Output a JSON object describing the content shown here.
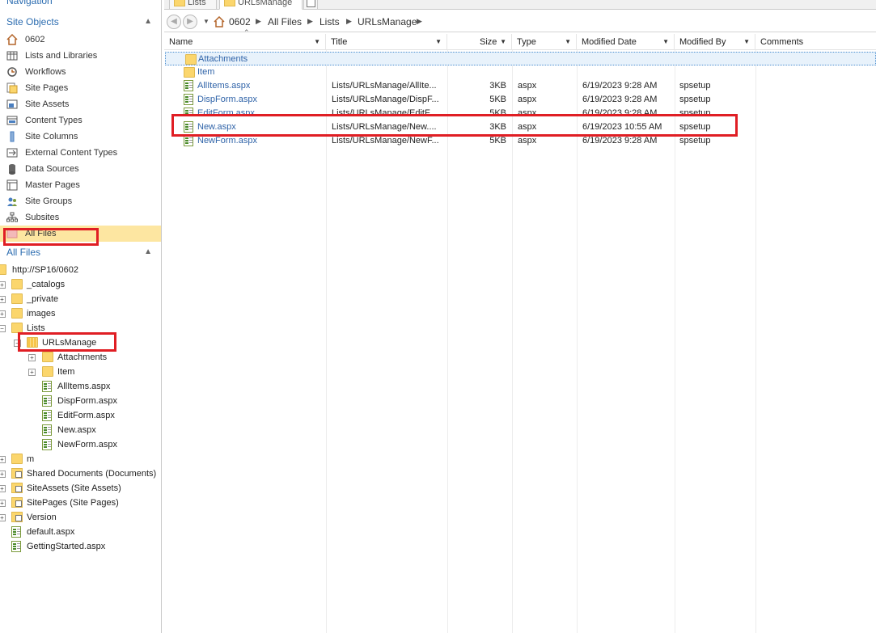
{
  "nav": {
    "title": "Navigation",
    "site_objects_header": "Site Objects",
    "site_objects": [
      {
        "label": "0602",
        "icon": "home-icon"
      },
      {
        "label": "Lists and Libraries",
        "icon": "list-icon"
      },
      {
        "label": "Workflows",
        "icon": "workflow-icon"
      },
      {
        "label": "Site Pages",
        "icon": "site-pages-icon"
      },
      {
        "label": "Site Assets",
        "icon": "site-assets-icon"
      },
      {
        "label": "Content Types",
        "icon": "content-types-icon"
      },
      {
        "label": "Site Columns",
        "icon": "site-columns-icon"
      },
      {
        "label": "External Content Types",
        "icon": "external-content-icon"
      },
      {
        "label": "Data Sources",
        "icon": "database-icon"
      },
      {
        "label": "Master Pages",
        "icon": "master-pages-icon"
      },
      {
        "label": "Site Groups",
        "icon": "groups-icon"
      },
      {
        "label": "Subsites",
        "icon": "subsites-icon"
      },
      {
        "label": "All Files",
        "icon": "all-files-icon"
      }
    ],
    "all_files_header": "All Files",
    "tree": {
      "root": "http://SP16/0602",
      "items": [
        {
          "label": "_catalogs"
        },
        {
          "label": "_private"
        },
        {
          "label": "images"
        },
        {
          "label": "Lists"
        },
        {
          "label": "URLsManage"
        },
        {
          "label": "Attachments"
        },
        {
          "label": "Item"
        },
        {
          "label": "AllItems.aspx"
        },
        {
          "label": "DispForm.aspx"
        },
        {
          "label": "EditForm.aspx"
        },
        {
          "label": "New.aspx"
        },
        {
          "label": "NewForm.aspx"
        },
        {
          "label": "m"
        },
        {
          "label": "Shared Documents (Documents)"
        },
        {
          "label": "SiteAssets (Site Assets)"
        },
        {
          "label": "SitePages (Site Pages)"
        },
        {
          "label": "Version"
        },
        {
          "label": "default.aspx"
        },
        {
          "label": "GettingStarted.aspx"
        }
      ]
    }
  },
  "tabs": [
    {
      "label": "Lists"
    },
    {
      "label": "URLsManage"
    }
  ],
  "breadcrumb": [
    "0602",
    "All Files",
    "Lists",
    "URLsManage"
  ],
  "columns": [
    "Name",
    "Title",
    "Size",
    "Type",
    "Modified Date",
    "Modified By",
    "Comments"
  ],
  "rows": [
    {
      "name": "Attachments",
      "title": "",
      "size": "",
      "type": "",
      "modified": "",
      "by": "",
      "kind": "folder"
    },
    {
      "name": "Item",
      "title": "",
      "size": "",
      "type": "",
      "modified": "",
      "by": "",
      "kind": "folder"
    },
    {
      "name": "AllItems.aspx",
      "title": "Lists/URLsManage/AllIte...",
      "size": "3KB",
      "type": "aspx",
      "modified": "6/19/2023 9:28 AM",
      "by": "spsetup",
      "kind": "aspx"
    },
    {
      "name": "DispForm.aspx",
      "title": "Lists/URLsManage/DispF...",
      "size": "5KB",
      "type": "aspx",
      "modified": "6/19/2023 9:28 AM",
      "by": "spsetup",
      "kind": "aspx"
    },
    {
      "name": "EditForm.aspx",
      "title": "Lists/URLsManage/EditF...",
      "size": "5KB",
      "type": "aspx",
      "modified": "6/19/2023 9:28 AM",
      "by": "spsetup",
      "kind": "aspx"
    },
    {
      "name": "New.aspx",
      "title": "Lists/URLsManage/New....",
      "size": "3KB",
      "type": "aspx",
      "modified": "6/19/2023 10:55 AM",
      "by": "spsetup",
      "kind": "aspx"
    },
    {
      "name": "NewForm.aspx",
      "title": "Lists/URLsManage/NewF...",
      "size": "5KB",
      "type": "aspx",
      "modified": "6/19/2023 9:28 AM",
      "by": "spsetup",
      "kind": "aspx"
    }
  ],
  "colors": {
    "link": "#2f63a8",
    "header_blue": "#2b6cb0",
    "selected_nav": "#fde6a1",
    "highlight_red": "#e01e24"
  }
}
